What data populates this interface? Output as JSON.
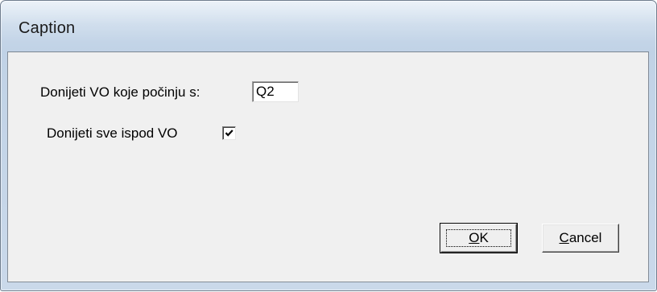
{
  "window": {
    "title": "Caption"
  },
  "form": {
    "prefix_label": "Donijeti VO koje počinju s:",
    "prefix_value": "Q2",
    "include_below_label": "Donijeti sve ispod VO",
    "include_below_checked": true
  },
  "buttons": {
    "ok_label": "OK",
    "cancel_label": "Cancel"
  },
  "icons": {
    "checkmark": "check-icon"
  }
}
